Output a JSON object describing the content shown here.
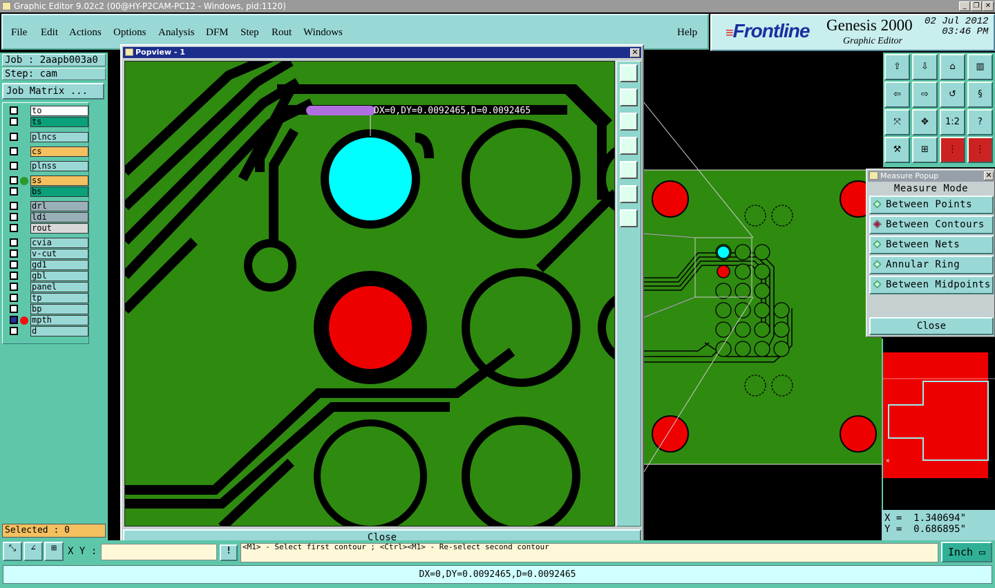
{
  "window": {
    "title": "Graphic Editor 9.02c2 (00@HY-P2CAM-PC12 - Windows, pid:1120)"
  },
  "menu": [
    "File",
    "Edit",
    "Actions",
    "Options",
    "Analysis",
    "DFM",
    "Step",
    "Rout",
    "Windows"
  ],
  "help": "Help",
  "brand": {
    "logo": "Frontline",
    "product": "Genesis 2000",
    "subtitle": "Graphic Editor",
    "date": "02 Jul 2012",
    "time": "03:46 PM"
  },
  "job": {
    "job_label": "Job : 2aapb003a0",
    "step_label": "Step: cam",
    "matrix_button": "Job Matrix ..."
  },
  "layers": [
    {
      "name": "to",
      "color": "#ffffff",
      "dot": ""
    },
    {
      "name": "ts",
      "color": "#0aa07a",
      "dot": ""
    },
    {
      "name": "plncs",
      "color": "#9ad8d6",
      "dot": ""
    },
    {
      "name": "cs",
      "color": "#f4c060",
      "dot": ""
    },
    {
      "name": "plnss",
      "color": "#9ad8d6",
      "dot": ""
    },
    {
      "name": "ss",
      "color": "#f4c060",
      "dot": "#2a9a2a"
    },
    {
      "name": "bs",
      "color": "#0aa07a",
      "dot": ""
    },
    {
      "name": "drl",
      "color": "#9ab0b8",
      "dot": ""
    },
    {
      "name": "ldi",
      "color": "#9ab0b8",
      "dot": ""
    },
    {
      "name": "rout",
      "color": "#d8d8d8",
      "dot": ""
    },
    {
      "name": "cvia",
      "color": "#9ad8d6",
      "dot": ""
    },
    {
      "name": "v-cut",
      "color": "#9ad8d6",
      "dot": ""
    },
    {
      "name": "gd1",
      "color": "#9ad8d6",
      "dot": ""
    },
    {
      "name": "gbl",
      "color": "#9ad8d6",
      "dot": ""
    },
    {
      "name": "panel",
      "color": "#9ad8d6",
      "dot": ""
    },
    {
      "name": "tp",
      "color": "#9ad8d6",
      "dot": ""
    },
    {
      "name": "bp",
      "color": "#9ad8d6",
      "dot": ""
    },
    {
      "name": "mpth",
      "color": "#9ad8d6",
      "dot": "#ee1111"
    },
    {
      "name": "d",
      "color": "#9ad8d6",
      "dot": ""
    }
  ],
  "selected": "Selected : 0",
  "popview": {
    "title": "Popview - 1",
    "measure_text": "DX=0,DY=0.0092465,D=0.0092465",
    "close": "Close"
  },
  "measure_popup": {
    "title": "Measure Popup",
    "header": "Measure Mode",
    "options": [
      "Between Points",
      "Between Contours",
      "Between Nets",
      "Annular Ring",
      "Between Midpoints"
    ],
    "selected": "Between Contours",
    "close": "Close"
  },
  "tools": [
    "1:2",
    "?"
  ],
  "coords": {
    "x": "X =  1.340694\"",
    "y": "Y =  0.686895\""
  },
  "bottom": {
    "xy_label": "X Y :",
    "xy_value": "",
    "prompt": "<M1> - Select first contour ; <Ctrl><M1> - Re-select second contour",
    "units": "Inch"
  },
  "status": "DX=0,DY=0.0092465,D=0.0092465"
}
